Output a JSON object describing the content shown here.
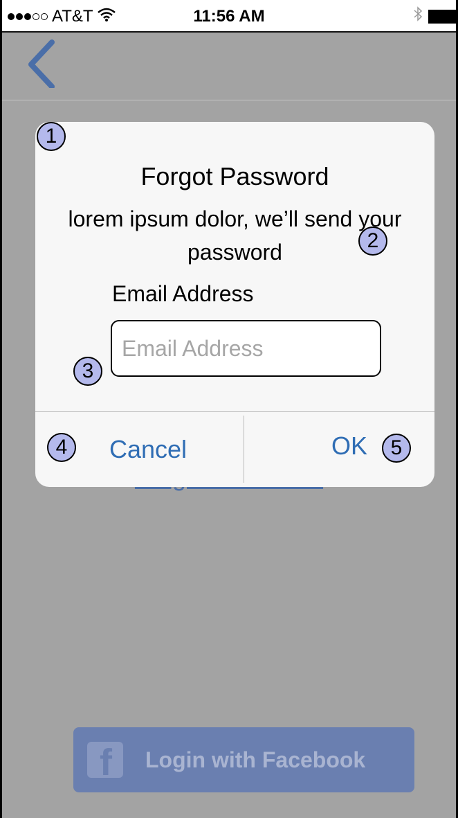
{
  "status_bar": {
    "carrier": "AT&T",
    "time": "11:56 AM",
    "signal_dots_full": 3,
    "signal_dots_total": 5,
    "wifi_icon": "wifi-icon",
    "bluetooth_icon": "bluetooth-icon",
    "battery_icon": "battery-icon"
  },
  "navbar": {
    "back_icon": "chevron-left-icon"
  },
  "background": {
    "forgot_link": "Forgot Password",
    "facebook_button": "Login with Facebook",
    "facebook_icon": "facebook-icon"
  },
  "dialog": {
    "title": "Forgot Password",
    "message": "lorem ipsum dolor, we’ll send your password",
    "email_label": "Email Address",
    "email_value": "",
    "email_placeholder": "Email Address",
    "cancel_label": "Cancel",
    "ok_label": "OK"
  },
  "annotations": [
    "1",
    "2",
    "3",
    "4",
    "5"
  ],
  "colors": {
    "accent_blue": "#2f6db4",
    "facebook_blue": "#6a7fb0",
    "dim_overlay": "#a3a3a3",
    "marker_fill": "#b4b9ec"
  }
}
